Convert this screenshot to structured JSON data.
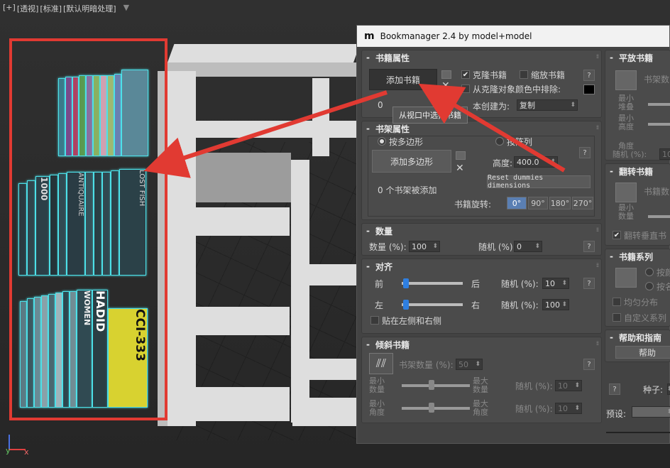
{
  "viewport": {
    "labels": [
      "[+]",
      "[透视]",
      "[标准]",
      "[默认明暗处理]"
    ],
    "axis_labels": {
      "y": "y",
      "x": "x"
    }
  },
  "book_spines": {
    "row2": [
      "1000",
      "ANTIQUAIRE",
      "LOST FISH"
    ],
    "row3": [
      "HADID",
      "WOMEN",
      "CCI-333"
    ]
  },
  "window": {
    "title": "Bookmanager 2.4 by model+model",
    "logo": "m"
  },
  "sec_books": {
    "title": "书籍属性",
    "add_button": "添加书籍",
    "clone_label": "克隆书籍",
    "scale_label": "缩放书籍",
    "exclude_label": "从克隆对象颜色中排除:",
    "create_label": "本创建为:",
    "create_value": "复制",
    "count_prefix": "0",
    "tooltip": "从视口中选择书籍",
    "help": "?"
  },
  "sec_shelf": {
    "title": "书架属性",
    "by_poly": "按多边形",
    "by_array": "按阵列",
    "add_poly": "添加多边形",
    "shelves_added": "0 个书架被添加",
    "height_label": "高度:",
    "height_value": "400.0",
    "reset_button": "Reset dummies dimensions",
    "rotation_label": "书籍旋转:",
    "rotations": [
      "0°",
      "90°",
      "180°",
      "270°"
    ],
    "help": "?"
  },
  "sec_count": {
    "title": "数量",
    "count_label": "数量 (%):",
    "count_value": "100",
    "random_label": "随机 (%)",
    "random_value": "0",
    "help": "?"
  },
  "sec_align": {
    "title": "对齐",
    "front": "前",
    "back": "后",
    "left": "左",
    "right": "右",
    "random_label1": "随机 (%):",
    "random_value1": "10",
    "random_label2": "随机 (%):",
    "random_value2": "100",
    "stick_label": "贴在左侧和右侧",
    "help": "?"
  },
  "sec_tilt": {
    "title": "倾斜书籍",
    "shelf_count_label": "书架数量 (%):",
    "shelf_count_value": "50",
    "min_count": "最小 数量",
    "max_count": "最大 数量",
    "min_angle": "最小 角度",
    "max_angle": "最大 角度",
    "random_label1": "随机 (%):",
    "random_value1": "10",
    "random_label2": "随机 (%):",
    "random_value2": "10",
    "help": "?"
  },
  "right_col": {
    "flat_title": "平放书籍",
    "flat_shelf": "书架数",
    "min_stack": "最小 堆叠",
    "min_height": "最小 高度",
    "angle": "角度",
    "random": "随机 (%):",
    "random_value": "10",
    "flip_title": "翻转书籍",
    "flip_count": "书籍数",
    "min_count": "最小 数量",
    "flip_vertical": "翻转垂直书",
    "series_title": "书籍系列",
    "by_color": "按颜",
    "by_name": "按名",
    "even_dist": "均匀分布",
    "custom_series": "自定义系列",
    "help_title": "帮助和指南",
    "help_button": "帮助",
    "help_q": "?",
    "seed_label": "种子:",
    "preset_label": "预设:"
  },
  "colors": {
    "accent_red": "#e13a32",
    "highlight_cyan": "#4de0e8",
    "knob_blue": "#2f7fe0"
  }
}
